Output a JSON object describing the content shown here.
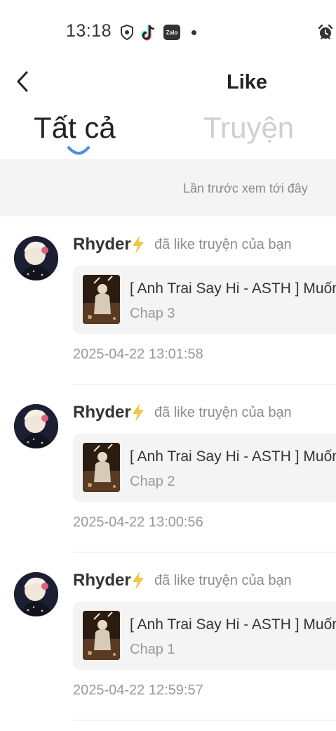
{
  "status_bar": {
    "time": "13:18",
    "icons": [
      "shield-icon",
      "tiktok-icon",
      "zalo-icon",
      "notification-dot-icon",
      "alarm-icon"
    ],
    "zalo_label": "Zalo"
  },
  "header": {
    "title": "Like",
    "back_icon": "chevron-left-icon"
  },
  "tabs": [
    {
      "label": "Tất cả",
      "active": true
    },
    {
      "label": "Truyện",
      "active": false
    }
  ],
  "colors": {
    "accent": "#4a90e2",
    "bolt": "#f5c542"
  },
  "banner": {
    "text": "Lần trước xem tới đây"
  },
  "notifications": [
    {
      "user": "Rhyder",
      "action": "đã like truyện của bạn",
      "story_title": "[ Anh Trai Say Hi - ASTH ] Muốn",
      "chapter": "Chap 3",
      "timestamp": "2025-04-22 13:01:58"
    },
    {
      "user": "Rhyder",
      "action": "đã like truyện của bạn",
      "story_title": "[ Anh Trai Say Hi - ASTH ] Muốn",
      "chapter": "Chap 2",
      "timestamp": "2025-04-22 13:00:56"
    },
    {
      "user": "Rhyder",
      "action": "đã like truyện của bạn",
      "story_title": "[ Anh Trai Say Hi - ASTH ] Muốn",
      "chapter": "Chap 1",
      "timestamp": "2025-04-22 12:59:57"
    }
  ]
}
